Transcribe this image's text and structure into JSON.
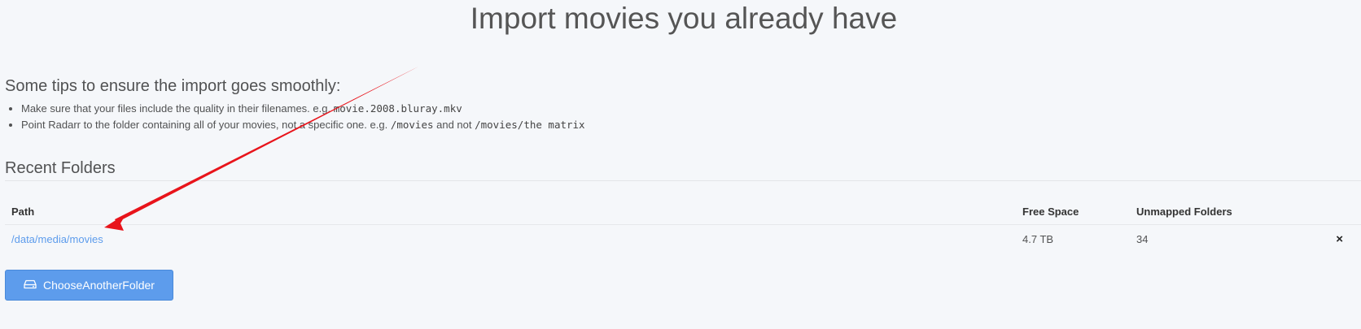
{
  "page": {
    "title": "Import movies you already have"
  },
  "tips": {
    "heading": "Some tips to ensure the import goes smoothly:",
    "items": [
      {
        "text": "Make sure that your files include the quality in their filenames. e.g. ",
        "code": "movie.2008.bluray.mkv"
      },
      {
        "text": "Point Radarr to the folder containing all of your movies, not a specific one. e.g. ",
        "code": "/movies",
        "middle": " and not ",
        "code2": "/movies/the matrix"
      }
    ]
  },
  "recent_folders": {
    "heading": "Recent Folders",
    "columns": {
      "path": "Path",
      "free_space": "Free Space",
      "unmapped": "Unmapped Folders"
    },
    "rows": [
      {
        "path": "/data/media/movies",
        "free_space": "4.7 TB",
        "unmapped": "34",
        "remove_icon": "×"
      }
    ]
  },
  "choose_button": {
    "label": "ChooseAnotherFolder",
    "icon": "drive-icon"
  },
  "colors": {
    "accent": "#5d9cec",
    "annotation_arrow": "#e8141b"
  }
}
